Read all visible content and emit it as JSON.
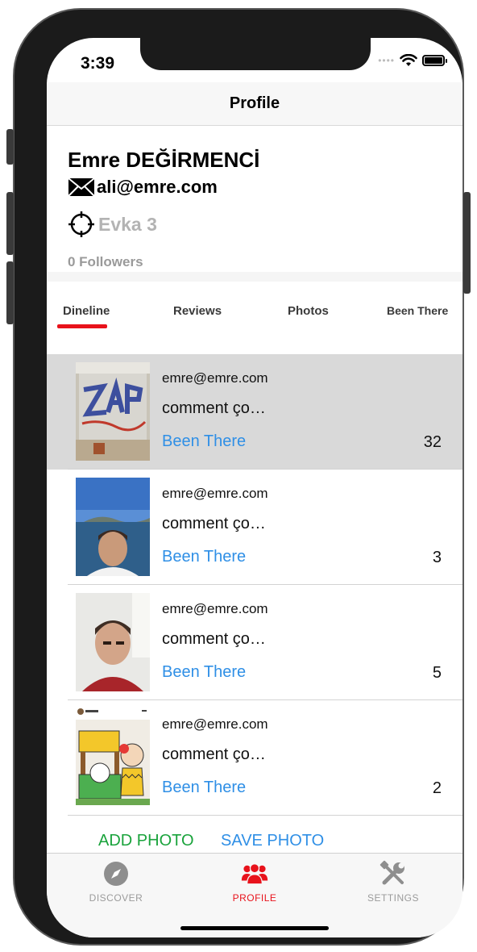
{
  "status_bar": {
    "time": "3:39"
  },
  "nav": {
    "title": "Profile"
  },
  "profile": {
    "name": "Emre DEĞİRMENCİ",
    "email": "ali@emre.com",
    "location": "Evka 3",
    "followers": "0 Followers"
  },
  "tabs": [
    {
      "label": "Dineline",
      "active": true
    },
    {
      "label": "Reviews",
      "active": false
    },
    {
      "label": "Photos",
      "active": false
    },
    {
      "label": "Been There",
      "active": false
    }
  ],
  "feed": [
    {
      "email": "emre@emre.com",
      "comment": "comment ço…",
      "tag": "Been There",
      "count": "32",
      "thumb": "graffiti-wall-photo"
    },
    {
      "email": "emre@emre.com",
      "comment": "comment ço…",
      "tag": "Been There",
      "count": "3",
      "thumb": "seaside-selfie-photo"
    },
    {
      "email": "emre@emre.com",
      "comment": "comment ço…",
      "tag": "Been There",
      "count": "5",
      "thumb": "indoor-selfie-photo"
    },
    {
      "email": "emre@emre.com",
      "comment": "comment ço…",
      "tag": "Been There",
      "count": "2",
      "thumb": "peanuts-cartoon-photo"
    }
  ],
  "actions": {
    "add_photo": "ADD PHOTO",
    "save_photo": "SAVE PHOTO"
  },
  "tab_bar": [
    {
      "label": "DISCOVER",
      "icon": "compass-icon",
      "active": false
    },
    {
      "label": "PROFILE",
      "icon": "people-icon",
      "active": true
    },
    {
      "label": "SETTINGS",
      "icon": "tools-icon",
      "active": false
    }
  ],
  "colors": {
    "accent_red": "#e8121b",
    "link_blue": "#2f8fe6",
    "add_green": "#1aa33c",
    "selected_row": "#d9d9d9"
  }
}
